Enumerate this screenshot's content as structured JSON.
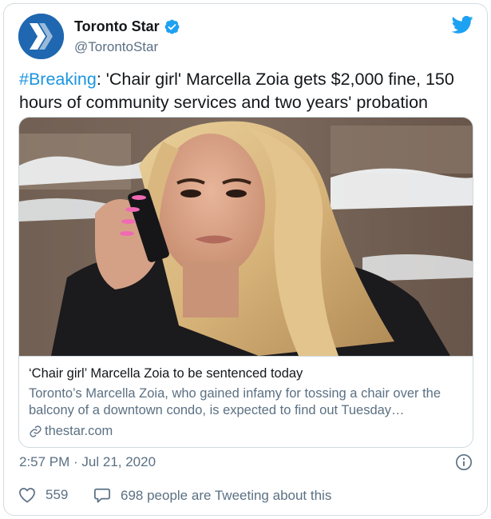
{
  "author": {
    "display_name": "Toronto Star",
    "handle": "@TorontoStar",
    "verified": true
  },
  "tweet": {
    "hashtag": "#Breaking",
    "text": ": 'Chair girl' Marcella Zoia gets $2,000 fine, 150 hours of community services and two years' probation"
  },
  "link_card": {
    "title": "‘Chair girl’ Marcella Zoia to be sentenced today",
    "description": "Toronto’s Marcella Zoia, who gained infamy for tossing a chair over the balcony of a downtown condo, is expected to find out Tuesday…",
    "domain": "thestar.com"
  },
  "timestamp": "2:57 PM · Jul 21, 2020",
  "actions": {
    "likes": "559",
    "tweeting": "698 people are Tweeting about this"
  },
  "colors": {
    "brand_blue": "#1f67b0",
    "twitter_blue": "#1da1f2",
    "link_blue": "#1b95e0",
    "secondary_text": "#5b7083"
  },
  "icons": [
    "toronto-star-logo",
    "verified-badge-icon",
    "twitter-bird-icon",
    "link-icon",
    "info-icon",
    "heart-icon",
    "speech-bubble-icon"
  ]
}
